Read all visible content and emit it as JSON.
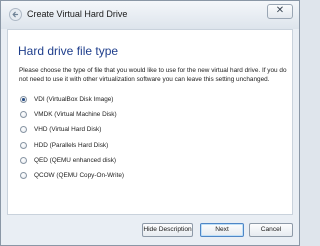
{
  "window": {
    "title": "Create Virtual Hard Drive",
    "close_glyph": "✕"
  },
  "page": {
    "heading": "Hard drive file type",
    "description": "Please choose the type of file that you would like to use for the new virtual hard drive. If you do not need to use it with other virtualization software you can leave this setting unchanged."
  },
  "options": [
    {
      "label": "VDI (VirtualBox Disk Image)",
      "checked": true
    },
    {
      "label": "VMDK (Virtual Machine Disk)",
      "checked": false
    },
    {
      "label": "VHD (Virtual Hard Disk)",
      "checked": false
    },
    {
      "label": "HDD (Parallels Hard Disk)",
      "checked": false
    },
    {
      "label": "QED (QEMU enhanced disk)",
      "checked": false
    },
    {
      "label": "QCOW (QEMU Copy-On-Write)",
      "checked": false
    }
  ],
  "buttons": {
    "hide_description": "Hide Description",
    "next": "Next",
    "cancel": "Cancel"
  },
  "colors": {
    "heading": "#1e3e8c",
    "window_bg": "#e9eef4",
    "content_bg": "#ffffff"
  },
  "icons": {
    "back": "back-arrow-icon",
    "close": "close-icon"
  }
}
